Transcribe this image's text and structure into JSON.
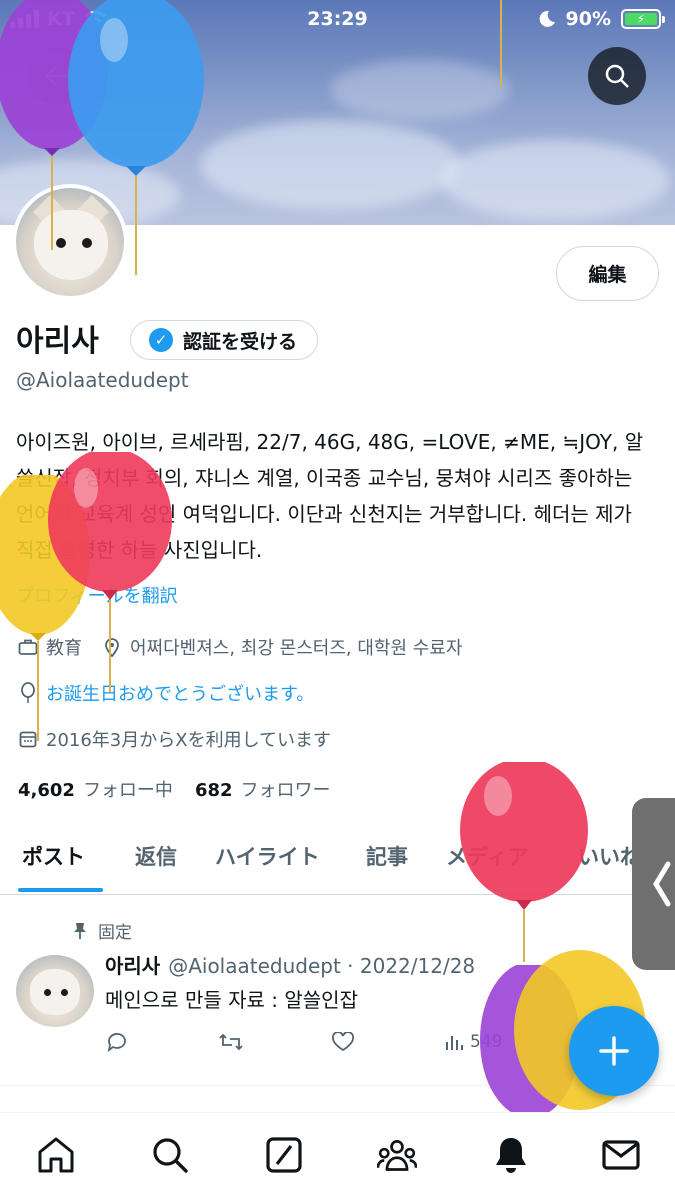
{
  "status_bar": {
    "carrier": "KT",
    "time": "23:29",
    "battery": "90%"
  },
  "profile": {
    "edit_label": "編集",
    "name": "아리사",
    "verify_label": "認証を受ける",
    "handle": "@Aiolaatedudept",
    "bio": "아이즈원, 아이브, 르세라핌, 22/7, 46G, 48G, =LOVE, ≠ME, ≒JOY, 알쓸신잡, 정치부 회의, 쟈니스 계열, 이국종 교수님, 뭉쳐야 시리즈 좋아하는 언어학/교육계 성인 여덕입니다. 이단과 신천지는 거부합니다. 헤더는 제가 직접 촬영한 하늘 사진입니다.",
    "translate_label": "プロフィールを翻訳",
    "category": "教育",
    "location": "어쩌다벤져스, 최강 몬스터즈, 대학원 수료자",
    "birthday": "お誕生日おめでとうございます。",
    "joined": "2016年3月からXを利用しています",
    "following_count": "4,602",
    "following_label": "フォロー中",
    "followers_count": "682",
    "followers_label": "フォロワー"
  },
  "tabs": [
    "ポスト",
    "返信",
    "ハイライト",
    "記事",
    "メディア",
    "いいね"
  ],
  "pinned_post": {
    "pinned_label": "固定",
    "author": "아리사",
    "handle_date": "@Aiolaatedudept · 2022/12/28",
    "text": "메인으로 만들 자료 : 알쓸인잡",
    "views": "549"
  },
  "colors": {
    "accent": "#1d9bf0",
    "text": "#0f1419",
    "muted": "#536471"
  }
}
